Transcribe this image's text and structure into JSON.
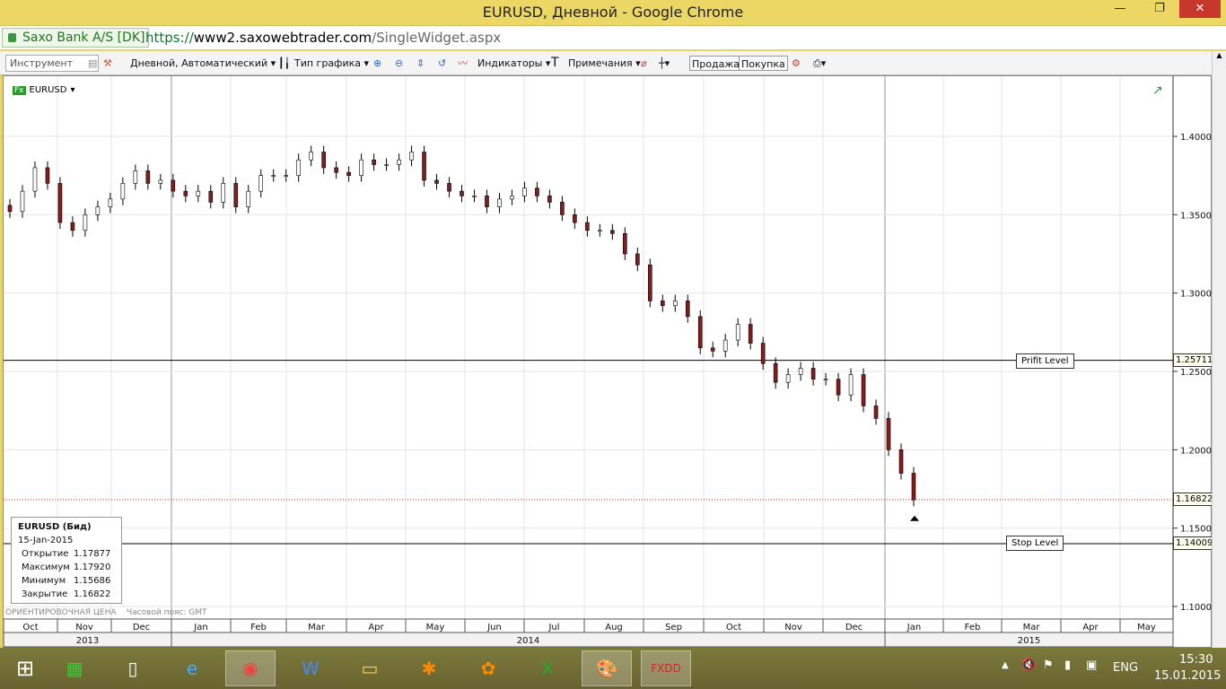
{
  "window": {
    "title": "EURUSD, Дневной - Google Chrome",
    "minimize": "—",
    "maximize": "❐",
    "close": "✕"
  },
  "address": {
    "site_badge": "Saxo Bank A/S [DK]",
    "url_scheme": "https://",
    "url_host": "www2.saxowebtrader.com",
    "url_path": "/SingleWidget.aspx"
  },
  "toolbar": {
    "instrument_placeholder": "Инструмент",
    "period": "Дневной, Автоматический",
    "chart_type": "Тип графика",
    "indicators": "Индикаторы",
    "notes": "Примечания",
    "sell": "Продажа",
    "buy": "Покупка"
  },
  "chart_data": {
    "type": "candlestick",
    "symbol": "EURUSD",
    "ylim": [
      1.1,
      1.42
    ],
    "yticks": [
      "1.10000",
      "1.15000",
      "1.20000",
      "1.25000",
      "1.30000",
      "1.35000",
      "1.40000"
    ],
    "yvalues": [
      1.1,
      1.15,
      1.2,
      1.25,
      1.3,
      1.35,
      1.4
    ],
    "months": [
      "Oct",
      "Nov",
      "Dec",
      "Jan",
      "Feb",
      "Mar",
      "Apr",
      "May",
      "Jun",
      "Jul",
      "Aug",
      "Sep",
      "Oct",
      "Nov",
      "Dec",
      "Jan",
      "Feb",
      "Mar",
      "Apr",
      "May"
    ],
    "years": [
      "2013",
      "2014",
      "2015"
    ],
    "closes": [
      1.352,
      1.365,
      1.38,
      1.37,
      1.345,
      1.34,
      1.35,
      1.355,
      1.36,
      1.37,
      1.378,
      1.37,
      1.372,
      1.365,
      1.362,
      1.365,
      1.358,
      1.37,
      1.355,
      1.365,
      1.375,
      1.375,
      1.375,
      1.385,
      1.39,
      1.38,
      1.377,
      1.375,
      1.385,
      1.382,
      1.382,
      1.385,
      1.39,
      1.372,
      1.37,
      1.365,
      1.362,
      1.362,
      1.355,
      1.36,
      1.362,
      1.367,
      1.362,
      1.358,
      1.35,
      1.345,
      1.34,
      1.34,
      1.338,
      1.325,
      1.318,
      1.295,
      1.292,
      1.295,
      1.285,
      1.265,
      1.263,
      1.27,
      1.28,
      1.268,
      1.255,
      1.243,
      1.248,
      1.252,
      1.245,
      1.245,
      1.235,
      1.248,
      1.228,
      1.22,
      1.2,
      1.185,
      1.168
    ],
    "profit_level": {
      "label": "Prifit Level",
      "value": "1.25711",
      "price": 1.25711
    },
    "stop_level": {
      "label": "Stop Level",
      "value": "1.14009",
      "price": 1.14009
    },
    "current_price": {
      "value": "1.16822",
      "price": 1.16822
    },
    "footer_note": "ОРИЕНТИРОВОЧНАЯ ЦЕНА",
    "timezone": "Часовой пояс: GMT"
  },
  "infobox": {
    "title": "EURUSD (Бид)",
    "date": "15-Jan-2015",
    "rows": [
      {
        "label": "Открытие",
        "value": "1.17877"
      },
      {
        "label": "Максимум",
        "value": "1.17920"
      },
      {
        "label": "Минимум",
        "value": "1.15686"
      },
      {
        "label": "Закрытие",
        "value": "1.16822"
      }
    ]
  },
  "taskbar": {
    "time": "15:30",
    "date": "15.01.2015",
    "lang": "ENG"
  }
}
